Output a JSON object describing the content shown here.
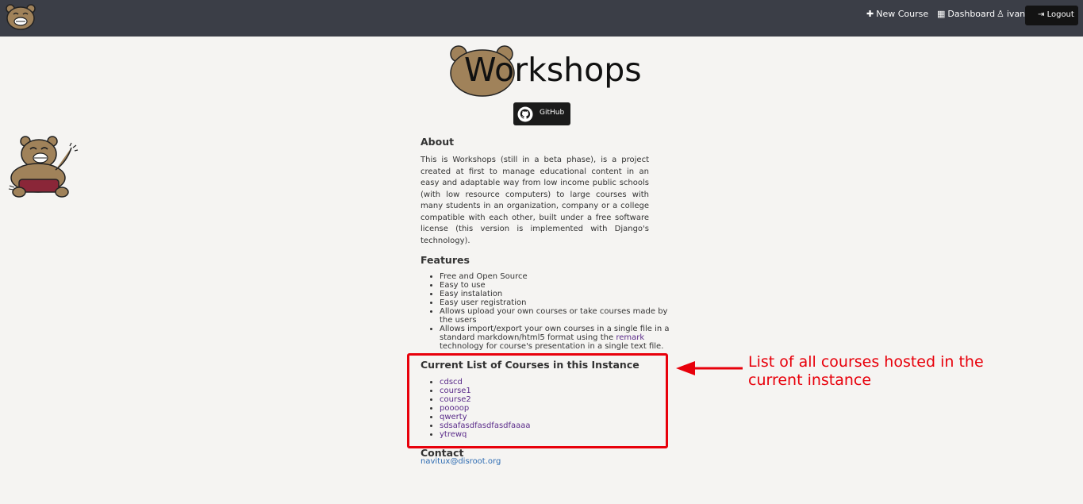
{
  "nav": {
    "new_course": "New Course",
    "dashboard": "Dashboard",
    "user": "ivan",
    "logout": "Logout"
  },
  "header": {
    "title": "Workshops",
    "github": "GitHub"
  },
  "about": {
    "heading": "About",
    "text": "This is Workshops (still in a beta phase), is a project created at first to manage educational content in an easy and adaptable way from low income public schools (with low resource computers) to large courses with many students in an organization, company or a college compatible with each other, built under a free software license (this version is implemented with Django's technology)."
  },
  "features": {
    "heading": "Features",
    "items": [
      "Free and Open Source",
      "Easy to use",
      "Easy instalation",
      "Easy user registration",
      "Allows upload your own courses or take courses made by the users"
    ],
    "last_item_pre": "Allows import/export your own courses in a single file in a standard markdown/html5 format using the",
    "last_item_link": "remark",
    "last_item_post": "technology for course's presentation in a single text file."
  },
  "courses": {
    "heading": "Current List of Courses in this Instance",
    "items": [
      "cdscd",
      "course1",
      "course2",
      "poooop",
      "qwerty",
      "sdsafasdfasdfasdfaaaa",
      "ytrewq"
    ]
  },
  "contact": {
    "heading": "Contact",
    "email": "navitux@disroot.org"
  },
  "annotation": {
    "text": "List of all courses hosted in the current instance"
  },
  "colors": {
    "topbar": "#3b3e47",
    "annotation_red": "#e8000b",
    "link_purple": "#5a2b8a",
    "email_blue": "#2f6db3",
    "bear_brown": "#a0825a"
  },
  "icons": [
    "bear-logo-icon",
    "plus-icon",
    "table-icon",
    "user-icon",
    "logout-icon",
    "github-icon",
    "bear-mascot-icon",
    "arrow-icon"
  ]
}
